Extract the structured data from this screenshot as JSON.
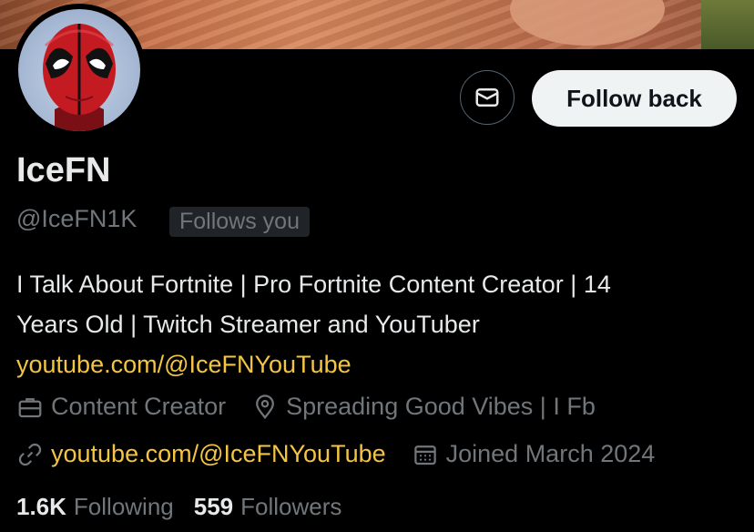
{
  "profile": {
    "display_name": "IceFN",
    "handle": "@IceFN1K",
    "follows_you_badge": "Follows you",
    "bio_line1": "I Talk About Fortnite | Pro Fortnite Content Creator | 14",
    "bio_line2": "Years Old | Twitch Streamer and YouTuber",
    "bio_link": "youtube.com/@IceFNYouTube"
  },
  "actions": {
    "message_icon": "mail-icon",
    "follow_back_label": "Follow back"
  },
  "meta": {
    "category": "Content Creator",
    "category_icon": "briefcase-icon",
    "location": "Spreading Good Vibes | I Fb",
    "location_icon": "location-pin-icon",
    "website": "youtube.com/@IceFNYouTube",
    "website_icon": "link-icon",
    "joined": "Joined March 2024",
    "joined_icon": "calendar-icon"
  },
  "stats": {
    "following_count": "1.6K",
    "following_label": "Following",
    "followers_count": "559",
    "followers_label": "Followers"
  },
  "colors": {
    "background": "#000000",
    "accent_link": "#f4c542",
    "muted_text": "#71767b",
    "primary_text": "#e7e9ea",
    "follow_button_bg": "#eff3f4"
  }
}
